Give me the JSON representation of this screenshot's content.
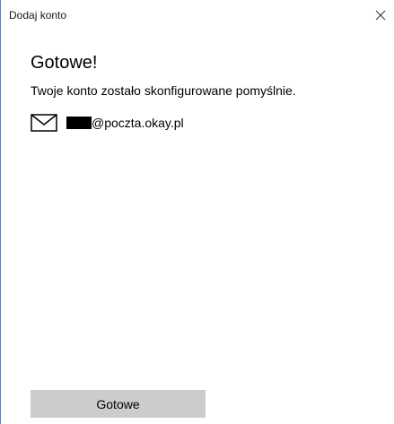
{
  "window": {
    "title": "Dodaj konto",
    "close_icon": "close-icon"
  },
  "main": {
    "heading": "Gotowe!",
    "message": "Twoje konto zostało skonfigurowane pomyślnie.",
    "account": {
      "icon": "mail-icon",
      "email_visible_part": "@poczta.okay.pl"
    }
  },
  "footer": {
    "done_label": "Gotowe"
  },
  "colors": {
    "window_border": "#4a86c8",
    "button_bg": "#cccccc"
  }
}
